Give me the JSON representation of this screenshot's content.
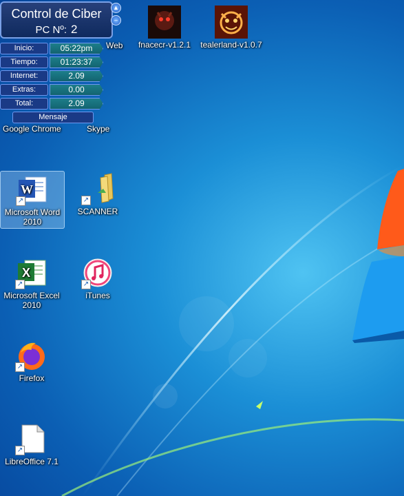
{
  "ciber_panel": {
    "title": "Control de Ciber",
    "pc_label": "PC Nº:",
    "pc_number": "2",
    "rows": [
      {
        "label": "Inicio:",
        "value": "05:22pm"
      },
      {
        "label": "Tiempo:",
        "value": "01:23:37"
      },
      {
        "label": "Internet:",
        "value": "2.09"
      },
      {
        "label": "Extras:",
        "value": "0.00"
      },
      {
        "label": "Total:",
        "value": "2.09"
      }
    ],
    "message_button": "Mensaje"
  },
  "desktop": {
    "partial_labels": {
      "web": "Web",
      "chrome": "Google Chrome",
      "skype": "Skype"
    },
    "icons": {
      "fnacecr": "fnacecr-v1.2.1",
      "tealerland": "tealerland-v1.0.7",
      "word": "Microsoft Word 2010",
      "scanner": "SCANNER",
      "excel": "Microsoft Excel 2010",
      "itunes": "iTunes",
      "firefox": "Firefox",
      "libreoffice": "LibreOffice 7.1"
    }
  },
  "colors": {
    "panel_bg": "#0f2a5e",
    "value_bg": "#1d7e8a",
    "wallpaper": "#1b8fd6"
  }
}
